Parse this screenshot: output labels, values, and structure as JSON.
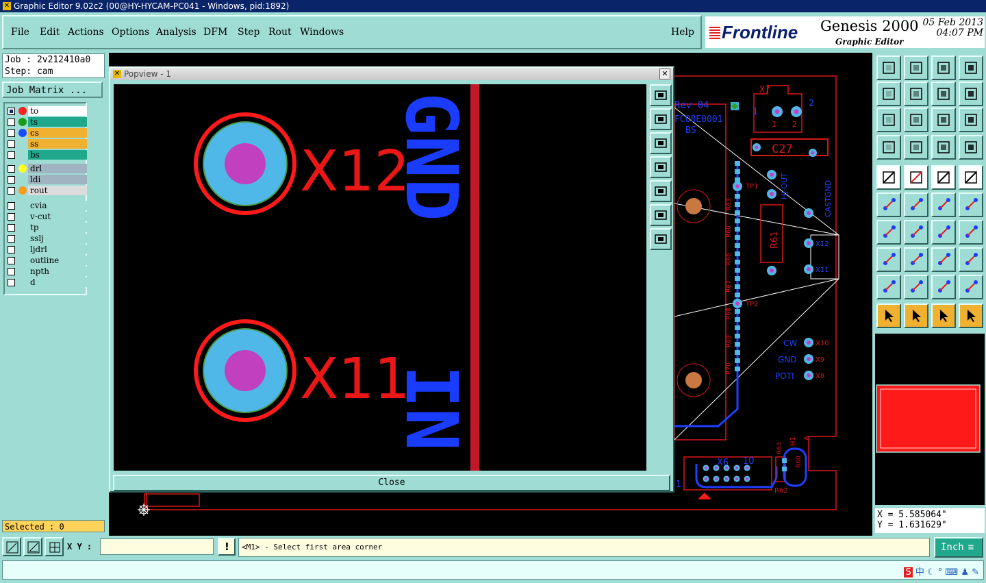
{
  "window_title": "Graphic Editor 9.02c2 (00@HY-HYCAM-PC041 - Windows, pid:1892)",
  "menu": [
    "File",
    "Edit",
    "Actions",
    "Options",
    "Analysis",
    "DFM",
    "Step",
    "Rout",
    "Windows"
  ],
  "help": "Help",
  "brand": {
    "logo": "Frontline",
    "product": "Genesis 2000",
    "subtitle": "Graphic Editor",
    "date": "05 Feb 2013",
    "time": "04:07 PM"
  },
  "job": {
    "job_line": "Job : 2v212410a0",
    "step_line": "Step: cam",
    "matrix_button": "Job Matrix ..."
  },
  "layers": [
    {
      "name": "to",
      "color": "#ff2020",
      "bg": "#ffffff"
    },
    {
      "name": "ts",
      "color": "#1a9c1a",
      "bg": "#1fa88c"
    },
    {
      "name": "cs",
      "color": "#1a4cff",
      "bg": "#f0b030"
    },
    {
      "name": "ss",
      "color": "",
      "bg": "#f0b030"
    },
    {
      "name": "bs",
      "color": "",
      "bg": "#1fa88c"
    },
    {
      "name": "drl",
      "color": "#ffff20",
      "bg": "#9fb4c0"
    },
    {
      "name": "ldi",
      "color": "",
      "bg": "#9fb4c0"
    },
    {
      "name": "rout",
      "color": "#ff9a1a",
      "bg": "#dcdcdc"
    },
    {
      "name": "cvia",
      "color": "",
      "bg": "#9fdcd4"
    },
    {
      "name": "v-cut",
      "color": "",
      "bg": "#9fdcd4"
    },
    {
      "name": "tp",
      "color": "",
      "bg": "#9fdcd4"
    },
    {
      "name": "sslj",
      "color": "",
      "bg": "#9fdcd4"
    },
    {
      "name": "ljdrl",
      "color": "",
      "bg": "#9fdcd4"
    },
    {
      "name": "outline",
      "color": "",
      "bg": "#9fdcd4"
    },
    {
      "name": "npth",
      "color": "",
      "bg": "#9fdcd4"
    },
    {
      "name": "d",
      "color": "",
      "bg": "#9fdcd4"
    }
  ],
  "selected": "Selected : 0",
  "popview": {
    "title": "Popview - 1",
    "close": "Close",
    "labels": [
      "X12",
      "X11",
      "GND",
      "IN"
    ]
  },
  "board_labels": [
    "Rev 04",
    "FC08E0001",
    "BS",
    "X7",
    "2",
    "1",
    "1",
    "2",
    "C27",
    "TP1",
    "HJ-OUT",
    "CASTGND",
    "R61",
    "X12",
    "X11",
    "GND",
    "IN",
    "TP2",
    "CW",
    "X10",
    "GND",
    "X9",
    "POTI",
    "X8",
    "X6",
    "10",
    "1",
    "H1",
    "A",
    "R62",
    "R63",
    "R60",
    "R66",
    "R67",
    "R68",
    "R69",
    "R70"
  ],
  "coords": {
    "x": "X = 5.585064\"",
    "y": "Y = 1.631629\""
  },
  "statusbar": {
    "xy_label": "X Y :",
    "prompt": "<M1> - Select first area corner",
    "units": "Inch"
  },
  "colors": {
    "panel": "#9fdcd4",
    "canvas": "#000000",
    "red": "#ff1a1a",
    "blue": "#1a3cff",
    "cyan": "#4fb8e8",
    "magenta": "#c040c0"
  }
}
